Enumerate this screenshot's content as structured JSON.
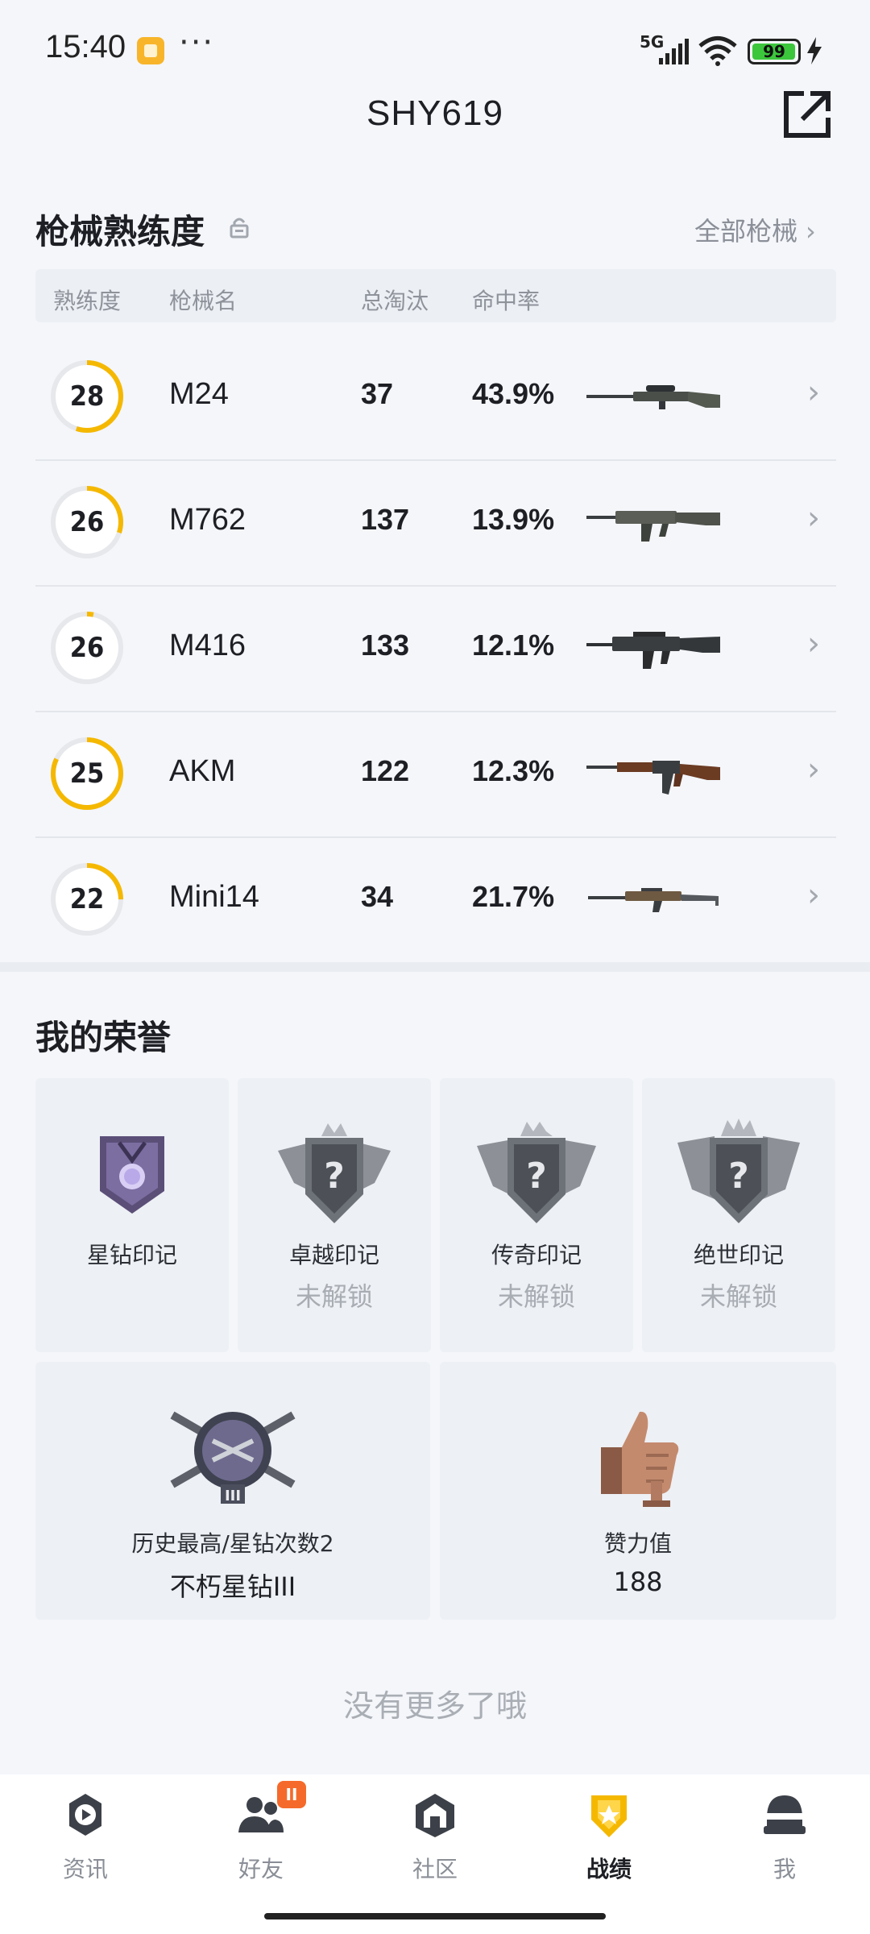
{
  "status_bar": {
    "time": "15:40",
    "more": "···",
    "network": "5G",
    "battery": "99",
    "battery_level": 0.99,
    "icons": [
      "app-notification-icon",
      "signal-icon",
      "wifi-icon",
      "battery-icon",
      "charging-icon"
    ]
  },
  "header": {
    "title": "SHY619",
    "share_icon": "share-external-icon"
  },
  "weapons": {
    "section_title": "枪械熟练度",
    "all_link": "全部枪械",
    "columns": {
      "proficiency": "熟练度",
      "name": "枪械名",
      "kills": "总淘汰",
      "hit_rate": "命中率"
    },
    "rows": [
      {
        "level": "28",
        "progress": 0.55,
        "name": "M24",
        "kills": "37",
        "hit_rate": "43.9%"
      },
      {
        "level": "26",
        "progress": 0.3,
        "name": "M762",
        "kills": "137",
        "hit_rate": "13.9%"
      },
      {
        "level": "26",
        "progress": 0.03,
        "name": "M416",
        "kills": "133",
        "hit_rate": "12.1%"
      },
      {
        "level": "25",
        "progress": 0.82,
        "name": "AKM",
        "kills": "122",
        "hit_rate": "12.3%"
      },
      {
        "level": "22",
        "progress": 0.25,
        "name": "Mini14",
        "kills": "34",
        "hit_rate": "21.7%"
      }
    ]
  },
  "honors": {
    "section_title": "我的荣誉",
    "marks": [
      {
        "label": "星钻印记",
        "status": ""
      },
      {
        "label": "卓越印记",
        "status": "未解锁"
      },
      {
        "label": "传奇印记",
        "status": "未解锁"
      },
      {
        "label": "绝世印记",
        "status": "未解锁"
      }
    ],
    "rank": {
      "label": "历史最高/星钻次数2",
      "value": "不朽星钻III"
    },
    "likes": {
      "label": "赞力值",
      "value": "188"
    }
  },
  "footer_text": "没有更多了哦",
  "nav": {
    "items": [
      {
        "label": "资讯",
        "icon": "news-icon"
      },
      {
        "label": "好友",
        "icon": "friends-icon",
        "badge": "II"
      },
      {
        "label": "社区",
        "icon": "community-icon"
      },
      {
        "label": "战绩",
        "icon": "record-icon",
        "active": true
      },
      {
        "label": "我",
        "icon": "profile-icon"
      }
    ]
  },
  "colors": {
    "accent": "#f5b800",
    "track": "#e6e8ec",
    "background": "#f4f6fa"
  }
}
